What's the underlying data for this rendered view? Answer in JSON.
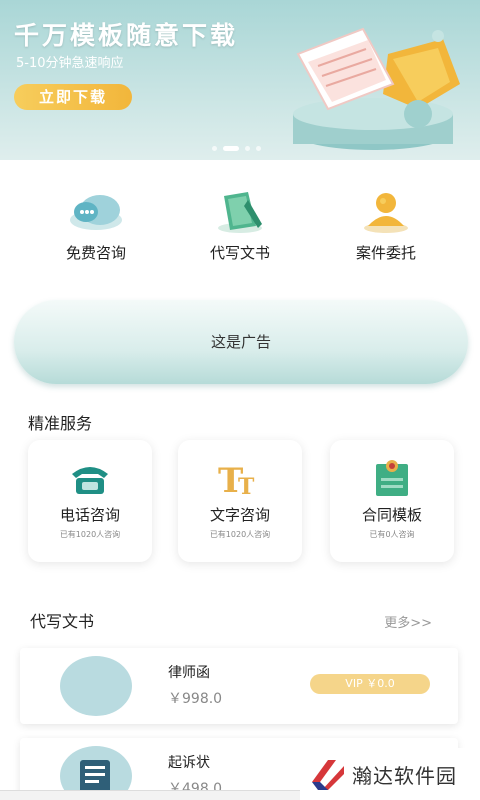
{
  "banner": {
    "title": "千万模板随意下载",
    "subtitle": "5-10分钟急速响应",
    "button_label": "立即下载",
    "slide_count": 4,
    "active_slide": 2
  },
  "quick_actions": [
    {
      "label": "免费咨询",
      "icon": "chat-bubble-icon"
    },
    {
      "label": "代写文书",
      "icon": "pen-document-icon"
    },
    {
      "label": "案件委托",
      "icon": "user-icon"
    }
  ],
  "ad": {
    "label": "这是广告"
  },
  "services": {
    "title": "精准服务",
    "cards": [
      {
        "title": "电话咨询",
        "sub": "已有1020人咨询",
        "icon": "telephone-icon"
      },
      {
        "title": "文字咨询",
        "sub": "已有1020人咨询",
        "icon": "text-tt-icon"
      },
      {
        "title": "合同模板",
        "sub": "已有0人咨询",
        "icon": "certificate-icon"
      }
    ]
  },
  "documents": {
    "title": "代写文书",
    "more_label": "更多>>",
    "items": [
      {
        "name": "律师函",
        "price": "￥998.0",
        "vip_label": "VIP ￥0.0"
      },
      {
        "name": "起诉状",
        "price": "￥498.0"
      }
    ]
  },
  "watermark": {
    "text": "瀚达软件园"
  },
  "colors": {
    "accent": "#a9d6d6",
    "gold": "#f2b63b",
    "vip": "#f5d58a"
  }
}
